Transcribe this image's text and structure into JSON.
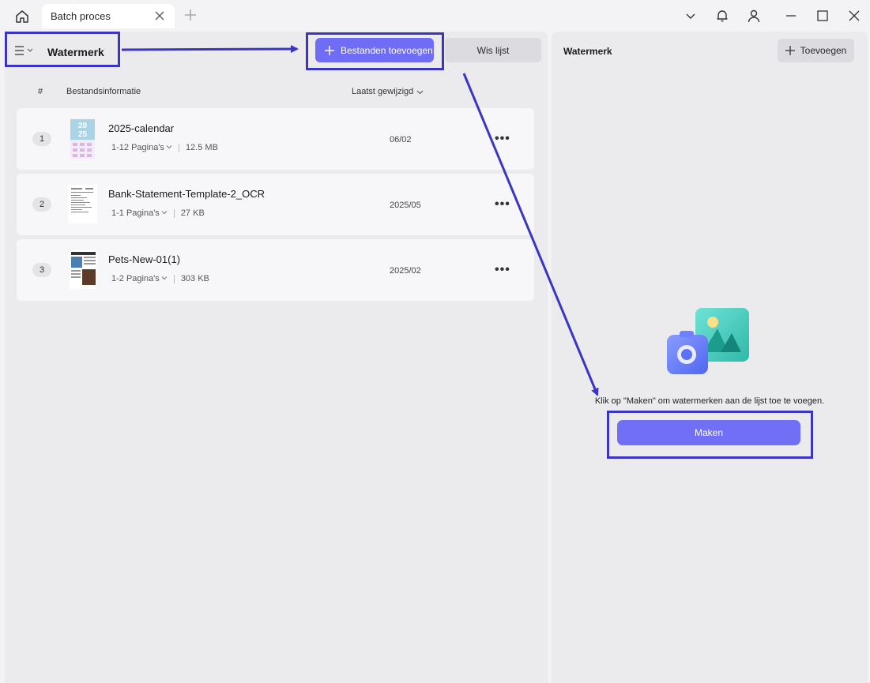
{
  "titlebar": {
    "tab_title": "Batch proces"
  },
  "left": {
    "mode_title": "Watermerk",
    "add_files_label": "Bestanden toevoegen",
    "clear_list_label": "Wis lijst",
    "columns": {
      "number": "#",
      "info": "Bestandsinformatie",
      "modified": "Laatst gewijzigd"
    },
    "files": [
      {
        "num": "1",
        "name": "2025-calendar",
        "pages": "1-12 Pagina's",
        "size": "12.5 MB",
        "date": "06/02"
      },
      {
        "num": "2",
        "name": "Bank-Statement-Template-2_OCR",
        "pages": "1-1 Pagina's",
        "size": "27 KB",
        "date": "2025/05"
      },
      {
        "num": "3",
        "name": "Pets-New-01(1)",
        "pages": "1-2 Pagina's",
        "size": "303 KB",
        "date": "2025/02"
      }
    ],
    "more_glyph": "•••"
  },
  "right": {
    "title": "Watermerk",
    "add_label": "Toevoegen",
    "empty_text": "Klik op \"Maken\" om watermerken aan de lijst toe te voegen.",
    "make_label": "Maken"
  },
  "colors": {
    "accent": "#6f6cf6",
    "annotation": "#3b36c2"
  }
}
